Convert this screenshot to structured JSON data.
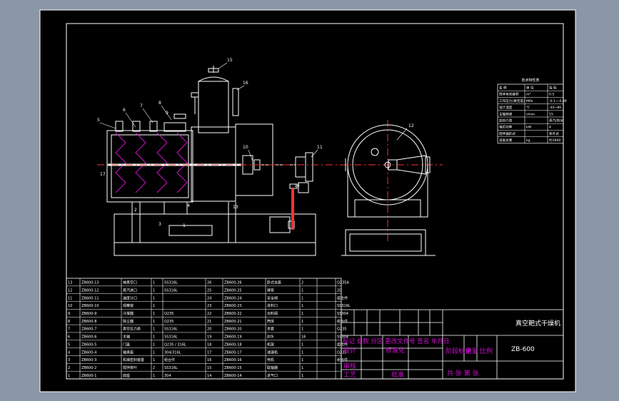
{
  "drawing": {
    "tech_table_title": "技术特性表",
    "tech_rows": [
      [
        "名 称",
        "单 位",
        "指 标"
      ],
      [
        "筒体有效容积",
        "m³",
        "0.5"
      ],
      [
        "工作压力(真空度)",
        "MPa",
        "-0.1~-0.09"
      ],
      [
        "设计温度",
        "℃",
        "-40~80"
      ],
      [
        "主轴转速",
        "r/min",
        "15"
      ],
      [
        "加热介质",
        "",
        "蒸汽/热水"
      ],
      [
        "电机功率",
        "kW",
        "4"
      ],
      [
        "搅拌器形式",
        "",
        "桨叶式"
      ],
      [
        "设备总重",
        "kg",
        "约1800"
      ]
    ],
    "callouts": [
      "1",
      "2",
      "3",
      "4",
      "5",
      "6",
      "7",
      "8",
      "9",
      "10",
      "11",
      "12",
      "13",
      "14",
      "15",
      "16",
      "17"
    ],
    "bom_rows": [
      [
        "13",
        "ZB600-13",
        "抽真空口",
        "1",
        "SS316L",
        "26",
        "ZB600-26",
        "卧式支座",
        "2",
        "",
        "Q235A"
      ],
      [
        "12",
        "ZB600-12",
        "蒸汽进口",
        "1",
        "SS316L",
        "25",
        "ZB600-25",
        "接管",
        "1",
        "",
        "20"
      ],
      [
        "11",
        "ZB600-11",
        "温度计口",
        "1",
        "",
        "24",
        "ZB600-24",
        "安全阀",
        "1",
        "",
        "组合件"
      ],
      [
        "10",
        "ZB600-10",
        "观察窗",
        "1",
        "",
        "23",
        "ZB600-23",
        "进料口",
        "1",
        "",
        "SS316L"
      ],
      [
        "9",
        "ZB600-9",
        "冷凝器",
        "1",
        "Q235",
        "22",
        "ZB600-22",
        "出料阀",
        "1",
        "",
        "SS304"
      ],
      [
        "8",
        "ZB600-8",
        "除尘器",
        "1",
        "Q235",
        "21",
        "ZB600-21",
        "筒体",
        "1",
        "",
        "组合件"
      ],
      [
        "7",
        "ZB600-7",
        "真空压力表",
        "1",
        "SS316L",
        "20",
        "ZB600-20",
        "夹套",
        "1",
        "",
        "Q235"
      ],
      [
        "6",
        "ZB600-6",
        "主轴",
        "1",
        "SS316L",
        "19",
        "ZB600-19",
        "封头",
        "16",
        "",
        "SS304"
      ],
      [
        "5",
        "ZB600-5",
        "门盖",
        "1",
        "Q235 / 316L",
        "18",
        "ZB600-18",
        "机架",
        "1",
        "",
        "组合件"
      ],
      [
        "4",
        "ZB600-4",
        "轴承座",
        "1",
        "304/316L",
        "17",
        "ZB600-17",
        "减速机",
        "1",
        "",
        "Q235"
      ],
      [
        "3",
        "ZB600-3",
        "机械密封装置",
        "1",
        "组合件",
        "16",
        "ZB600-16",
        "电机",
        "1",
        "",
        "组合件"
      ],
      [
        "2",
        "ZB600-2",
        "搅拌桨叶",
        "2",
        "SS316L",
        "15",
        "ZB600-15",
        "联轴器",
        "1",
        "",
        ""
      ],
      [
        "1",
        "ZB600-1",
        "底座",
        "1",
        "304",
        "14",
        "ZB600-14",
        "进气口",
        "1",
        "",
        ""
      ]
    ],
    "title_block": {
      "product_name": "真空耙式干燥机",
      "drawing_no": "ZB-600",
      "rev_header": "标记 处数 分区 更改文件号 签名 年月日",
      "designer": "设计",
      "standardized": "标准化",
      "stage_label": "阶段标记",
      "weight_label": "重量",
      "scale_label": "比例",
      "checker": "审核",
      "process": "工艺",
      "approved": "批准",
      "sheets": "共  张  第  张"
    }
  }
}
